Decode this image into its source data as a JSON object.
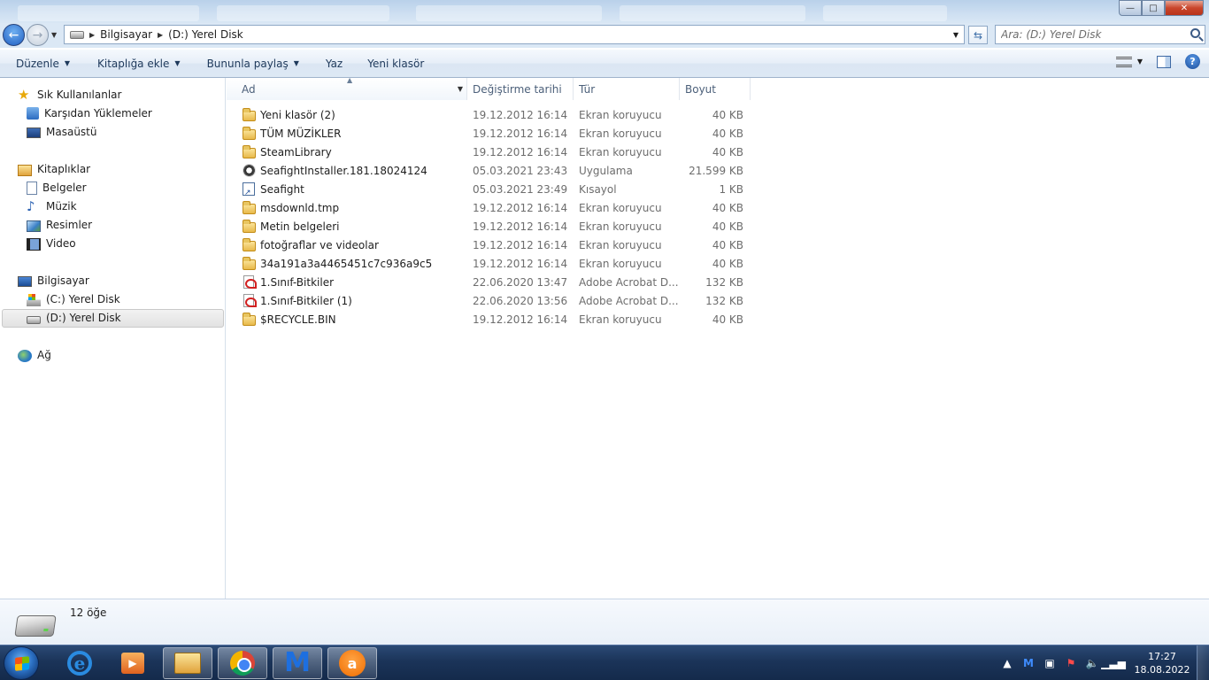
{
  "window": {
    "title_buttons": {
      "minimize": "—",
      "maximize": "□",
      "close": "✕"
    }
  },
  "address": {
    "crumbs": [
      "Bilgisayar",
      "(D:) Yerel Disk"
    ],
    "search_placeholder": "Ara: (D:) Yerel Disk"
  },
  "toolbar": {
    "organize": "Düzenle",
    "add_to_library": "Kitaplığa ekle",
    "share_with": "Bununla paylaş",
    "burn": "Yaz",
    "new_folder": "Yeni klasör"
  },
  "nav": {
    "favorites": "Sık Kullanılanlar",
    "downloads": "Karşıdan Yüklemeler",
    "desktop": "Masaüstü",
    "libraries": "Kitaplıklar",
    "documents": "Belgeler",
    "music": "Müzik",
    "pictures": "Resimler",
    "videos": "Video",
    "computer": "Bilgisayar",
    "drive_c": "(C:) Yerel Disk",
    "drive_d": "(D:) Yerel Disk",
    "network": "Ağ"
  },
  "columns": {
    "name": "Ad",
    "date": "Değiştirme tarihi",
    "type": "Tür",
    "size": "Boyut"
  },
  "files": [
    {
      "name": "Yeni klasör (2)",
      "date": "19.12.2012 16:14",
      "type": "Ekran koruyucu",
      "size": "40 KB",
      "icon": "folder-icon"
    },
    {
      "name": "TÜM MÜZİKLER",
      "date": "19.12.2012 16:14",
      "type": "Ekran koruyucu",
      "size": "40 KB",
      "icon": "folder-icon"
    },
    {
      "name": "SteamLibrary",
      "date": "19.12.2012 16:14",
      "type": "Ekran koruyucu",
      "size": "40 KB",
      "icon": "folder-icon"
    },
    {
      "name": "SeafightInstaller.181.18024124",
      "date": "05.03.2021 23:43",
      "type": "Uygulama",
      "size": "21.599 KB",
      "icon": "exe-icon"
    },
    {
      "name": "Seafight",
      "date": "05.03.2021 23:49",
      "type": "Kısayol",
      "size": "1 KB",
      "icon": "shortcut-icon"
    },
    {
      "name": "msdownld.tmp",
      "date": "19.12.2012 16:14",
      "type": "Ekran koruyucu",
      "size": "40 KB",
      "icon": "folder-icon"
    },
    {
      "name": "Metin belgeleri",
      "date": "19.12.2012 16:14",
      "type": "Ekran koruyucu",
      "size": "40 KB",
      "icon": "folder-icon"
    },
    {
      "name": "fotoğraflar ve videolar",
      "date": "19.12.2012 16:14",
      "type": "Ekran koruyucu",
      "size": "40 KB",
      "icon": "folder-icon"
    },
    {
      "name": "34a191a3a4465451c7c936a9c5",
      "date": "19.12.2012 16:14",
      "type": "Ekran koruyucu",
      "size": "40 KB",
      "icon": "folder-icon"
    },
    {
      "name": "1.Sınıf-Bitkiler",
      "date": "22.06.2020 13:47",
      "type": "Adobe Acrobat D...",
      "size": "132 KB",
      "icon": "pdf-icon"
    },
    {
      "name": "1.Sınıf-Bitkiler (1)",
      "date": "22.06.2020 13:56",
      "type": "Adobe Acrobat D...",
      "size": "132 KB",
      "icon": "pdf-icon"
    },
    {
      "name": "$RECYCLE.BIN",
      "date": "19.12.2012 16:14",
      "type": "Ekran koruyucu",
      "size": "40 KB",
      "icon": "folder-icon"
    }
  ],
  "details": {
    "item_count": "12 öğe"
  },
  "taskbar": {
    "time": "17:27",
    "date": "18.08.2022"
  }
}
